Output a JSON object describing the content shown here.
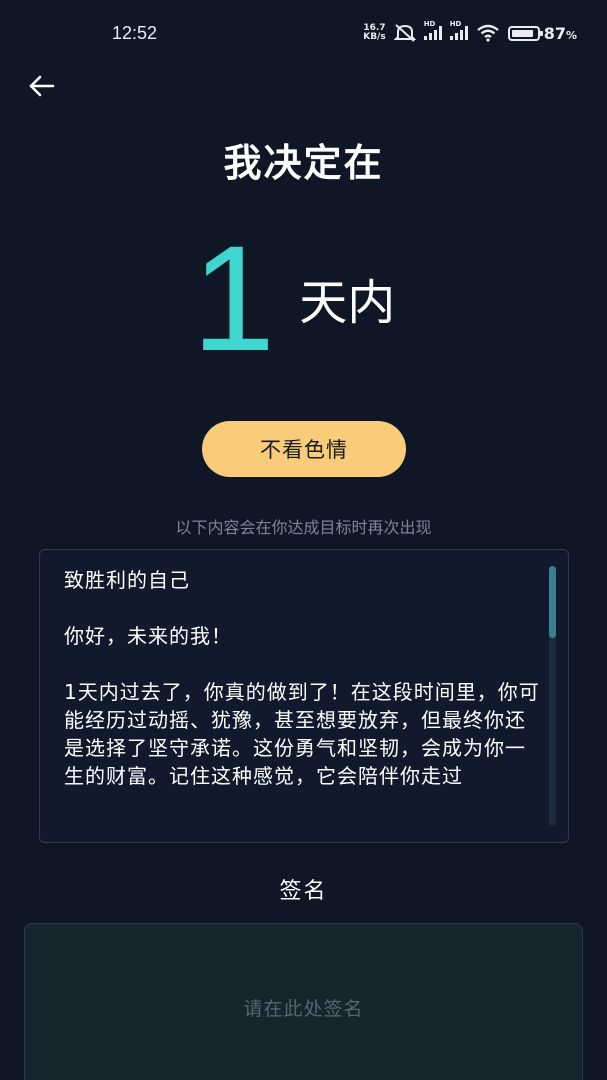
{
  "status_bar": {
    "time": "12:52",
    "net_speed_value": "16.7",
    "net_speed_unit": "KB/s",
    "signal_1_label": "HD",
    "signal_2_label": "HD",
    "battery_percent": "87",
    "battery_suffix": "%",
    "battery_level": 0.87
  },
  "header": {
    "back_icon": "arrow-left-icon"
  },
  "commitment": {
    "headline": "我决定在",
    "days": "1",
    "days_unit": "天内",
    "goal": "不看色情"
  },
  "letter": {
    "hint": "以下内容会在你达成目标时再次出现",
    "title": "致胜利的自己",
    "greeting": "你好，未来的我！",
    "body": "1天内过去了，你真的做到了！在这段时间里，你可能经历过动摇、犹豫，甚至想要放弃，但最终你还是选择了坚守承诺。这份勇气和坚韧，会成为你一生的财富。记住这种感觉，它会陪伴你走过"
  },
  "signature": {
    "label": "签名",
    "placeholder": "请在此处签名"
  },
  "colors": {
    "background": "#0f1626",
    "accent": "#3ed6cf",
    "pill": "#f9cc7a"
  }
}
